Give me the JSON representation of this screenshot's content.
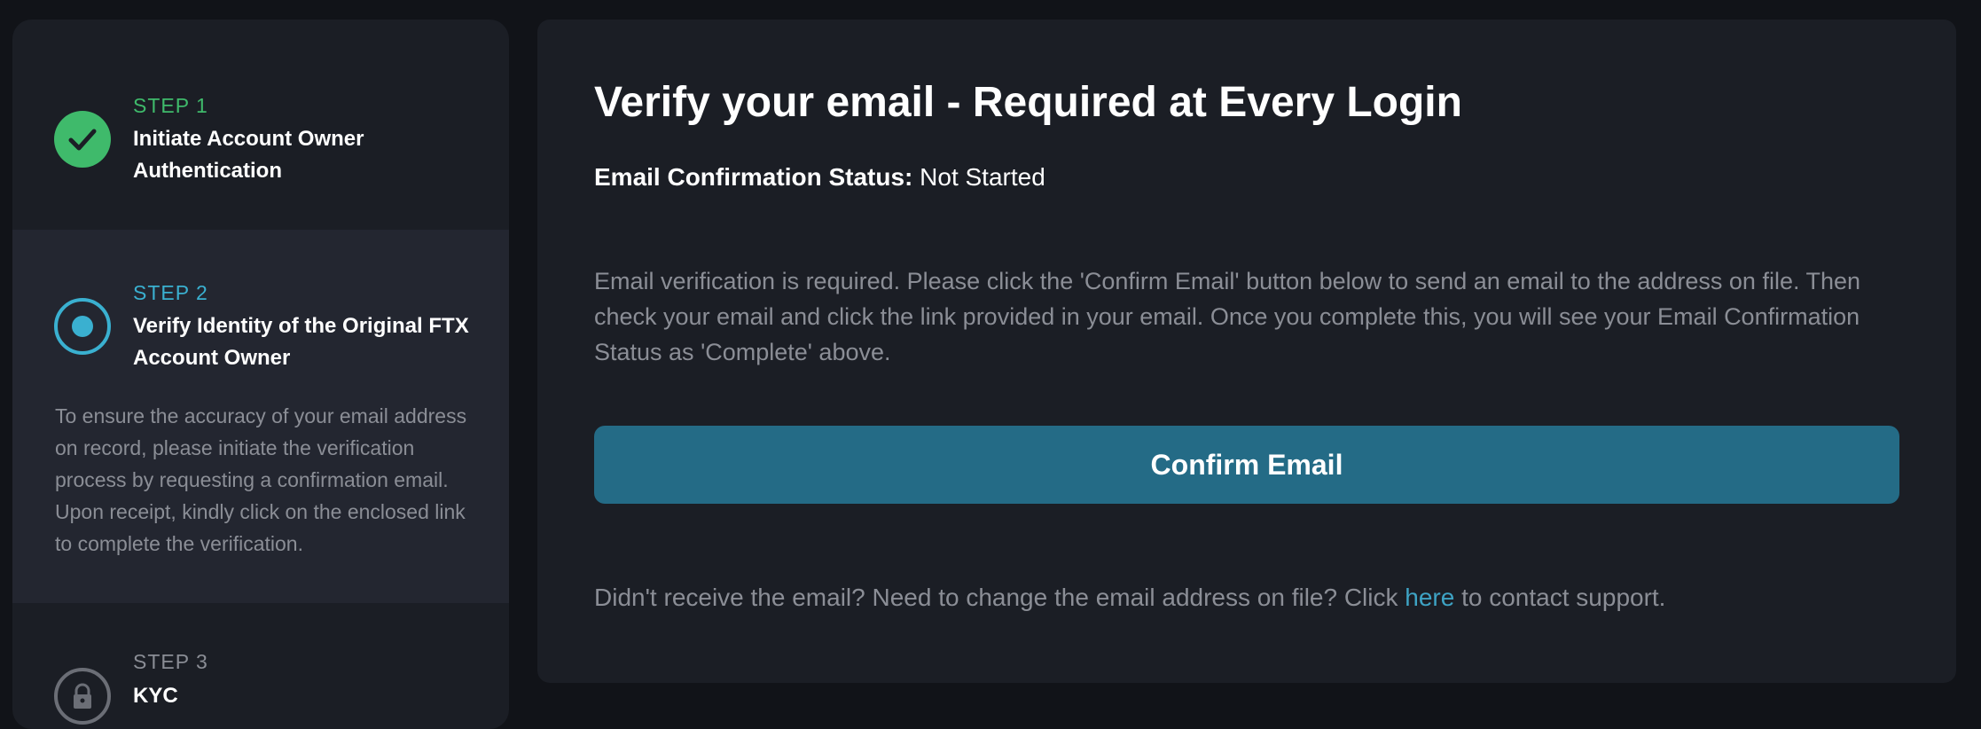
{
  "sidebar": {
    "steps": [
      {
        "number_label": "STEP 1",
        "title": "Initiate Account Owner Authentication",
        "state": "completed",
        "icon": "check-icon",
        "color": "#3fba6b"
      },
      {
        "number_label": "STEP 2",
        "title": "Verify Identity of the Original FTX Account Owner",
        "state": "active",
        "icon": "radio-active-icon",
        "color": "#3ab0d0",
        "description": "To ensure the accuracy of your email address on record, please initiate the verification process by requesting a confirmation email. Upon receipt, kindly click on the enclosed link to complete the verification."
      },
      {
        "number_label": "STEP 3",
        "title": "KYC",
        "state": "locked",
        "icon": "lock-icon",
        "color": "#6b6e76"
      }
    ]
  },
  "main": {
    "title": "Verify your email - Required at Every Login",
    "status_label": "Email Confirmation Status:",
    "status_value": "Not Started",
    "body": "Email verification is required. Please click the 'Confirm Email' button below to send an email to the address on file. Then check your email and click the link provided in your email. Once you complete this, you will see your Email Confirmation Status as 'Complete' above.",
    "confirm_button_label": "Confirm Email",
    "footer_prefix": "Didn't receive the email? Need to change the email address on file? Click ",
    "footer_link_label": "here",
    "footer_suffix": " to contact support."
  },
  "colors": {
    "page_bg": "#111318",
    "card_bg": "#1b1e25",
    "active_step_bg": "#232630",
    "button_bg": "#246b86",
    "link": "#3ea3c4",
    "muted_text": "#8b8e96"
  }
}
